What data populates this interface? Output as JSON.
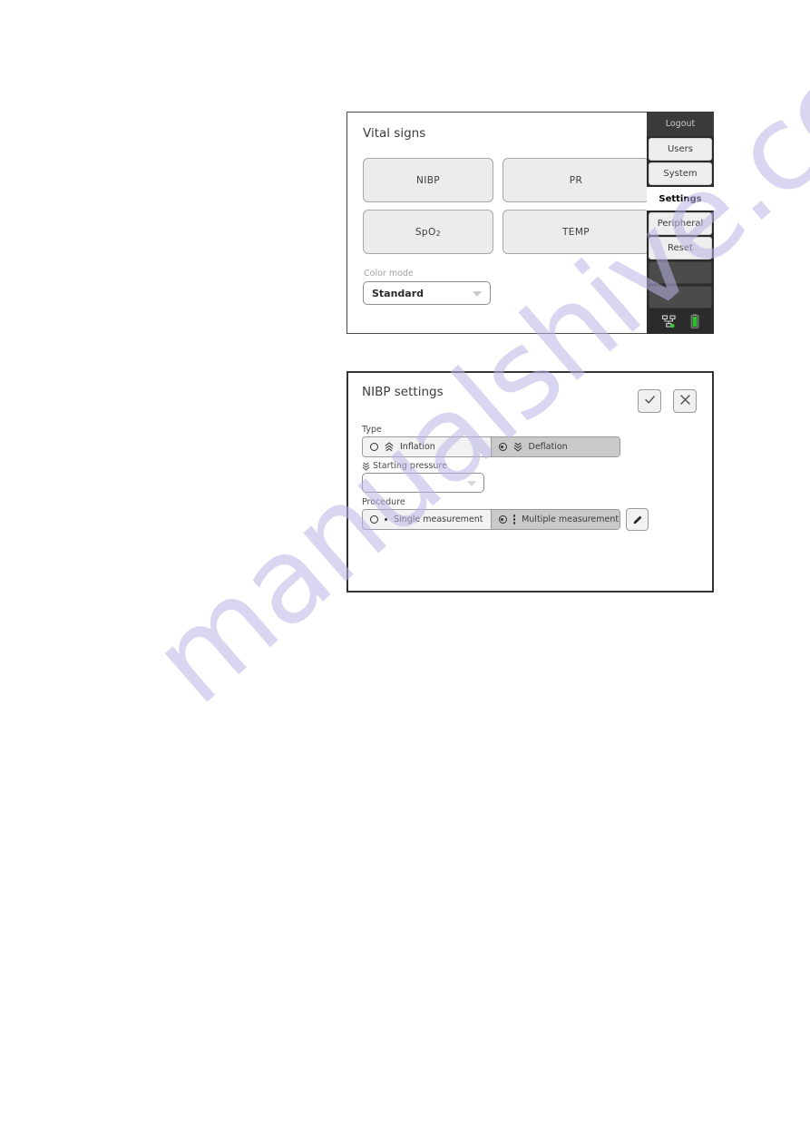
{
  "watermark": {
    "text": "manualshive.com"
  },
  "vital_panel": {
    "title": "Vital signs",
    "close_icon": "close-x-icon",
    "buttons": [
      {
        "label": "NIBP",
        "name": "nibp"
      },
      {
        "label": "PR",
        "name": "pr"
      },
      {
        "label": "SpO",
        "sub": "2",
        "name": "spo2"
      },
      {
        "label": "TEMP",
        "name": "temp"
      }
    ],
    "color_mode": {
      "label": "Color mode",
      "value": "Standard",
      "caret_icon": "chevron-down-icon"
    }
  },
  "sidebar": {
    "logout": "Logout",
    "items": [
      {
        "label": "Users",
        "active": false
      },
      {
        "label": "System",
        "active": false
      },
      {
        "label": "Settings",
        "active": true
      },
      {
        "label": "Peripheral",
        "active": false
      },
      {
        "label": "Reset",
        "active": false
      },
      {
        "label": "",
        "active": false
      },
      {
        "label": "",
        "active": false
      }
    ],
    "status": {
      "network_icon": "network-lan-icon",
      "battery_icon": "battery-full-icon",
      "network_color": "#33cc33",
      "battery_color": "#2fbe2f"
    }
  },
  "nibp_panel": {
    "title": "NIBP settings",
    "confirm_icon": "check-icon",
    "close_icon": "close-x-icon",
    "type": {
      "label": "Type",
      "options": [
        {
          "label": "Inflation",
          "selected": false,
          "icon": "chevron-up-double-icon"
        },
        {
          "label": "Deflation",
          "selected": true,
          "icon": "chevron-down-double-icon"
        }
      ]
    },
    "starting_pressure": {
      "label": "Starting pressure",
      "icon": "chevron-down-double-icon",
      "value": "",
      "caret_icon": "chevron-down-icon"
    },
    "procedure": {
      "label": "Procedure",
      "options": [
        {
          "label": "Single measurement",
          "selected": false,
          "icon": "single-dot-icon"
        },
        {
          "label": "Multiple measurement",
          "selected": true,
          "icon": "three-dots-vertical-icon"
        }
      ],
      "edit_icon": "pencil-icon"
    }
  }
}
